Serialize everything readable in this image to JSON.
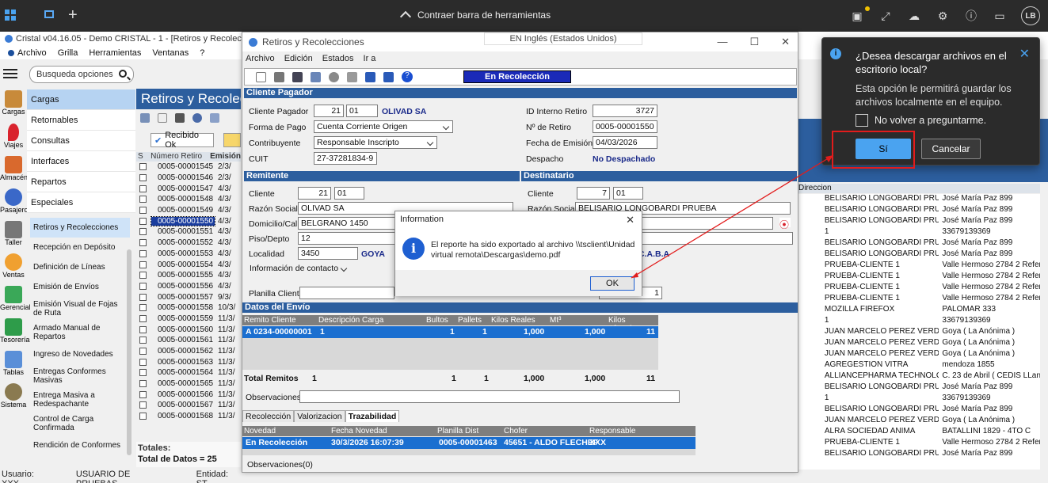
{
  "remote_bar": {
    "center_label": "Contraer barra de herramientas",
    "avatar": "LB",
    "icons": [
      "image-icon",
      "expand-icon",
      "cloud-icon",
      "gear-icon",
      "info-icon",
      "monitor-icon"
    ]
  },
  "app": {
    "title": "Cristal v04.16.05 - Demo CRISTAL - 1 - [Retiros y Recolecciones]",
    "menu": [
      "Archivo",
      "Grilla",
      "Herramientas",
      "Ventanas",
      "?"
    ],
    "search_placeholder": "Busqueda opciones",
    "left_icons": [
      "Cargas",
      "Viajes",
      "Almacén",
      "Pasajeros",
      "Taller",
      "Ventas",
      "Gerencial",
      "Tesorería",
      "Tablas",
      "Sistema"
    ],
    "categories": [
      "Cargas",
      "Retornables",
      "Consultas",
      "Interfaces",
      "Repartos",
      "Especiales"
    ],
    "sub_items": [
      "Retiros y Recolecciones",
      "Recepción en Depósito",
      "Definición de Líneas",
      "Emisión de Envíos",
      "Emisión Visual de Fojas de Ruta",
      "Armado Manual de Repartos",
      "Ingreso de Novedades",
      "Entregas Conformes Masivas",
      "Entrega Masiva a Redespachante",
      "Control de Carga Confirmada",
      "Rendición de Conformes"
    ],
    "module_header": "Retiros y Recolecciones",
    "recibido_btn": "Recibido Ok",
    "grid_left_headers": [
      "S",
      "Número Retiro",
      "Emisión"
    ],
    "grid_left_rows": [
      {
        "num": "0005-00001545",
        "date": "2/3/"
      },
      {
        "num": "0005-00001546",
        "date": "2/3/"
      },
      {
        "num": "0005-00001547",
        "date": "4/3/"
      },
      {
        "num": "0005-00001548",
        "date": "4/3/"
      },
      {
        "num": "0005-00001549",
        "date": "4/3/"
      },
      {
        "num": "0005-00001550",
        "date": "4/3/"
      },
      {
        "num": "0005-00001551",
        "date": "4/3/"
      },
      {
        "num": "0005-00001552",
        "date": "4/3/"
      },
      {
        "num": "0005-00001553",
        "date": "4/3/"
      },
      {
        "num": "0005-00001554",
        "date": "4/3/"
      },
      {
        "num": "0005-00001555",
        "date": "4/3/"
      },
      {
        "num": "0005-00001556",
        "date": "4/3/"
      },
      {
        "num": "0005-00001557",
        "date": "9/3/"
      },
      {
        "num": "0005-00001558",
        "date": "10/3/"
      },
      {
        "num": "0005-00001559",
        "date": "11/3/"
      },
      {
        "num": "0005-00001560",
        "date": "11/3/"
      },
      {
        "num": "0005-00001561",
        "date": "11/3/"
      },
      {
        "num": "0005-00001562",
        "date": "11/3/"
      },
      {
        "num": "0005-00001563",
        "date": "11/3/"
      },
      {
        "num": "0005-00001564",
        "date": "11/3/"
      },
      {
        "num": "0005-00001565",
        "date": "11/3/"
      },
      {
        "num": "0005-00001566",
        "date": "11/3/"
      },
      {
        "num": "0005-00001567",
        "date": "11/3/"
      },
      {
        "num": "0005-00001568",
        "date": "11/3/"
      }
    ],
    "totales_label": "Totales:",
    "total_datos": "Total de Datos = 25",
    "status_user": "Usuario: XXX",
    "status_name": "USUARIO DE PRUEBAS",
    "status_entidad": "Entidad: ST",
    "right_header": "Direccion",
    "right_rows": [
      {
        "a": "BELISARIO LONGOBARDI PRUEBA",
        "b": "José María Paz 899"
      },
      {
        "a": "BELISARIO LONGOBARDI PRUEBA",
        "b": "José María Paz 899"
      },
      {
        "a": "BELISARIO LONGOBARDI PRUEBA",
        "b": "José María Paz 899"
      },
      {
        "a": "1",
        "b": "33679139369"
      },
      {
        "a": "BELISARIO LONGOBARDI PRUEBA",
        "b": "José María Paz 899"
      },
      {
        "a": "BELISARIO LONGOBARDI PRUEBA",
        "b": "José María Paz 899"
      },
      {
        "a": "PRUEBA-CLIENTE 1",
        "b": "Valle Hermoso 2784 2 Refere"
      },
      {
        "a": "PRUEBA-CLIENTE 1",
        "b": "Valle Hermoso 2784 2 Refere"
      },
      {
        "a": "PRUEBA-CLIENTE 1",
        "b": "Valle Hermoso 2784 2 Refere"
      },
      {
        "a": "PRUEBA-CLIENTE 1",
        "b": "Valle Hermoso 2784 2 Refere"
      },
      {
        "a": "MOZILLA FIREFOX",
        "b": "PALOMAR 333"
      },
      {
        "a": "1",
        "b": "33679139369"
      },
      {
        "a": "JUAN MARCELO PEREZ VERDI",
        "b": "Goya ( La Anónima )"
      },
      {
        "a": "JUAN MARCELO PEREZ VERDI",
        "b": "Goya ( La Anónima )"
      },
      {
        "a": "JUAN MARCELO PEREZ VERDI",
        "b": "Goya ( La Anónima )"
      },
      {
        "a": "AGREGESTION VITRA",
        "b": "mendoza 1855"
      },
      {
        "a": "ALLIANCEPHARMA TECHNOLOGIE",
        "b": "C. 23 de Abril ( CEDIS LLano"
      },
      {
        "a": "BELISARIO LONGOBARDI PRUEBA",
        "b": "José María Paz 899"
      },
      {
        "a": "1",
        "b": "33679139369"
      },
      {
        "a": "BELISARIO LONGOBARDI PRUEBA",
        "b": "José María Paz 899"
      },
      {
        "a": "JUAN MARCELO PEREZ VERDI",
        "b": "Goya ( La Anónima )"
      },
      {
        "a": "ALRA SOCIEDAD ANIMA",
        "b": "BATALLINI 1829 - 4TO C"
      },
      {
        "a": "PRUEBA-CLIENTE 1",
        "b": "Valle Hermoso 2784 2 Refere"
      },
      {
        "a": "BELISARIO LONGOBARDI PRUEBA",
        "b": "José María Paz 899"
      }
    ]
  },
  "inner": {
    "title": "Retiros y Recolecciones",
    "language": "EN Inglés (Estados Unidos)",
    "menu": [
      "Archivo",
      "Edición",
      "Estados",
      "Ir a"
    ],
    "status": "En Recolección",
    "cliente_pagador": {
      "head": "Cliente Pagador",
      "label": "Cliente Pagador",
      "code": "21",
      "sub": "01",
      "name": "OLIVAD SA"
    },
    "forma_pago": {
      "label": "Forma de Pago",
      "value": "Cuenta Corriente Origen"
    },
    "contribuyente": {
      "label": "Contribuyente",
      "value": "Responsable Inscripto"
    },
    "cuit": {
      "label": "CUIT",
      "value": "27-37281834-9"
    },
    "id_interno": {
      "label": "ID Interno Retiro",
      "value": "3727"
    },
    "nro_retiro": {
      "label": "Nº de Retiro",
      "value": "0005-00001550"
    },
    "fecha_emision": {
      "label": "Fecha de Emisión",
      "value": "04/03/2026"
    },
    "despacho": {
      "label": "Despacho",
      "value": "No Despachado"
    },
    "remitente": {
      "head": "Remitente",
      "cliente_label": "Cliente",
      "cliente_code": "21",
      "cliente_sub": "01",
      "razon_label": "Razón Social",
      "razon": "OLIVAD SA",
      "domicilio_label": "Domicilio/Calle",
      "domicilio": "BELGRANO 1450",
      "piso_label": "Piso/Depto",
      "piso": "12",
      "localidad_label": "Localidad",
      "localidad": "3450",
      "localidad_name": "GOYA",
      "info_contacto": "Información de contacto",
      "planilla_label": "Planilla Cliente"
    },
    "destinatario": {
      "head": "Destinatario",
      "cliente_label": "Cliente",
      "cliente_code": "7",
      "cliente_sub": "01",
      "razon_label": "Razón Social",
      "razon": "BELISARIO LONGOBARDI PRUEBA",
      "localidad_name": "C.A.B.A",
      "planilla_num": "1"
    },
    "envio": {
      "head": "Datos del Envío",
      "cols": [
        "Remito Cliente",
        "Descripción Carga",
        "Bultos",
        "Pallets",
        "Kilos Reales",
        "Mt³",
        "Kilos Aforados"
      ],
      "row": [
        "A 0234-00000001",
        "1",
        "1",
        "1",
        "1,000",
        "1,000",
        "11"
      ],
      "totals_label": "Total Remitos",
      "totals": [
        "1",
        "1",
        "1",
        "1,000",
        "1,000",
        "11"
      ],
      "obs_label": "Observaciones"
    },
    "tabs": [
      "Recolección",
      "Valorizacion",
      "Trazabilidad"
    ],
    "novedades": {
      "cols": [
        "Novedad",
        "Fecha Novedad",
        "Planilla Dist",
        "Chofer",
        "Responsable"
      ],
      "row": [
        "En Recolección",
        "30/3/2026 16:07:39",
        "0005-00001463",
        "45651 - ALDO FLECHEF",
        "XXX"
      ],
      "obs_label": "Observaciones",
      "obs_value": "(0)"
    }
  },
  "info_dialog": {
    "title": "Information",
    "message": "El reporte ha sido exportado al archivo \\\\tsclient\\Unidad virtual remota\\Descargas\\demo.pdf",
    "ok": "OK"
  },
  "toast": {
    "title": "¿Desea descargar archivos en el escritorio local?",
    "body": "Esta opción le permitirá guardar los archivos localmente en el equipo.",
    "checkbox": "No volver a preguntarme.",
    "yes": "Sí",
    "cancel": "Cancelar"
  },
  "colors": {
    "accent_blue": "#4aa3f0",
    "header_blue": "#2c5e9e",
    "status_blue": "#1a2ab8",
    "annotation_red": "#e21c1c"
  }
}
